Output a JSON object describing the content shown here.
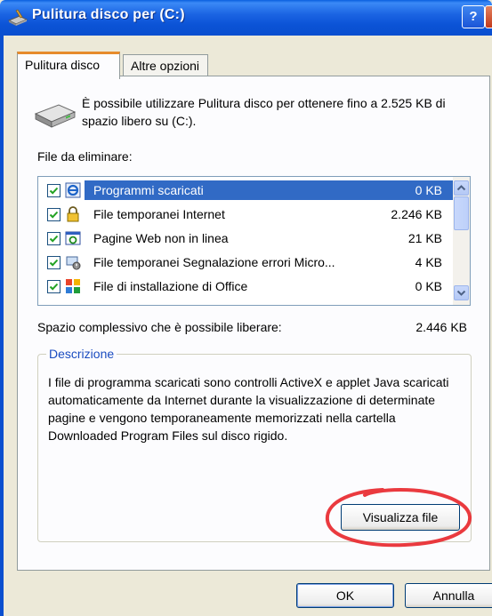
{
  "window": {
    "title": "Pulitura disco per  (C:)",
    "help_glyph": "?",
    "close_glyph": "✕",
    "title_icon": "disk-cleanup-icon"
  },
  "tabs": [
    {
      "label": "Pulitura disco",
      "active": true
    },
    {
      "label": "Altre opzioni",
      "active": false
    }
  ],
  "intro": {
    "icon": "hard-drive-icon",
    "text": "È possibile utilizzare Pulitura disco per ottenere fino a 2.525 KB di spazio libero su  (C:)."
  },
  "files_label": "File da eliminare:",
  "files": [
    {
      "name": "Programmi scaricati",
      "size": "0 KB",
      "checked": true,
      "selected": true,
      "icon": "ie-download-icon"
    },
    {
      "name": "File temporanei Internet",
      "size": "2.246 KB",
      "checked": true,
      "selected": false,
      "icon": "lock-icon"
    },
    {
      "name": "Pagine Web non in linea",
      "size": "21 KB",
      "checked": true,
      "selected": false,
      "icon": "offline-pages-icon"
    },
    {
      "name": "File temporanei Segnalazione errori Micro...",
      "size": "4 KB",
      "checked": true,
      "selected": false,
      "icon": "error-report-icon"
    },
    {
      "name": "File di installazione di Office",
      "size": "0 KB",
      "checked": true,
      "selected": false,
      "icon": "office-icon"
    }
  ],
  "total": {
    "label": "Spazio complessivo che è possibile liberare:",
    "value": "2.446 KB"
  },
  "description": {
    "legend": "Descrizione",
    "text": "I file di programma scaricati sono controlli ActiveX e applet Java scaricati automaticamente da Internet durante la visualizzazione di determinate pagine e vengono temporaneamente memorizzati nella cartella Downloaded Program Files sul disco rigido."
  },
  "buttons": {
    "view_files": "Visualizza file",
    "ok": "OK",
    "cancel": "Annulla"
  },
  "colors": {
    "titlebar": "#0a4fcf",
    "selection": "#316ac5",
    "annotation": "#e8252a",
    "legend": "#1a4cc0"
  }
}
